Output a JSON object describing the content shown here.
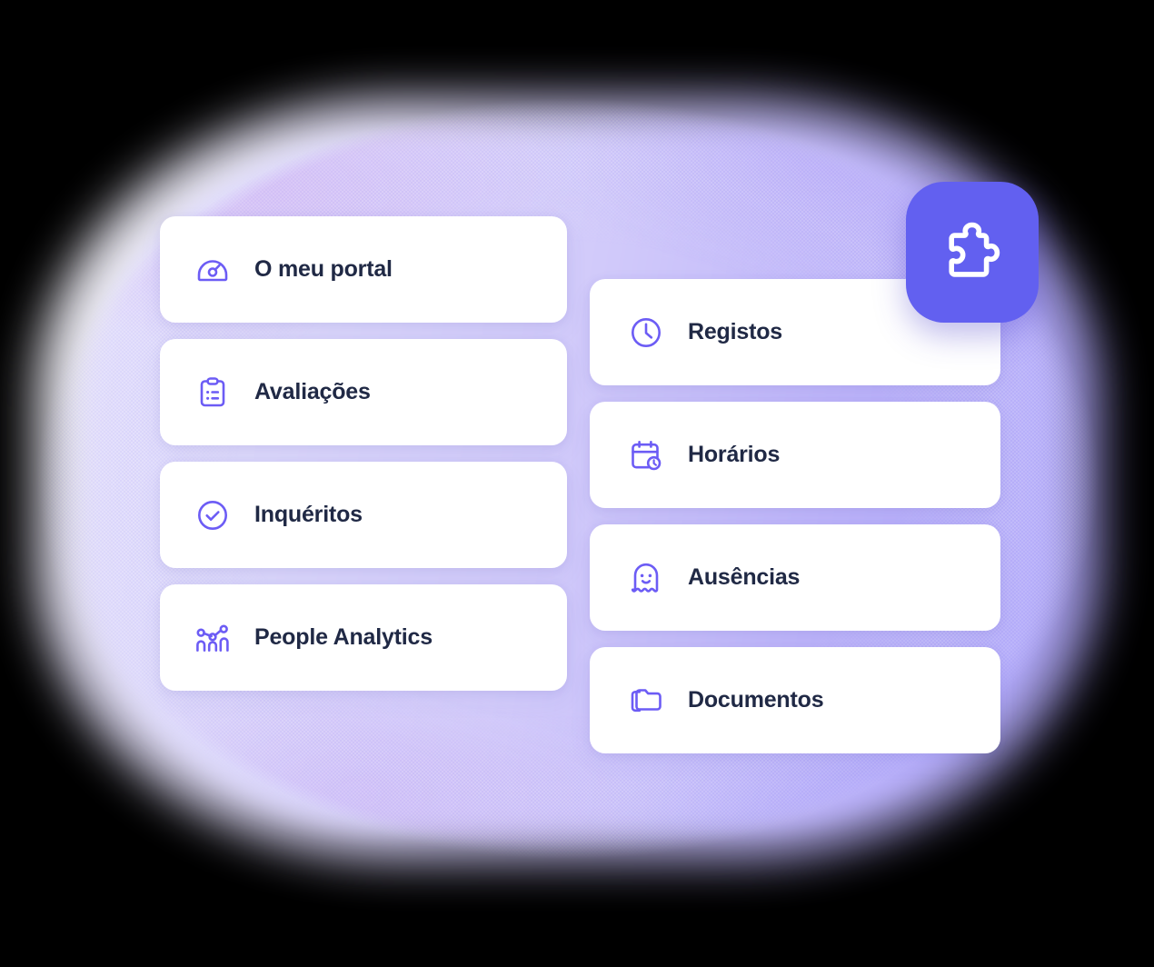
{
  "theme": {
    "accent": "#6260f0",
    "icon_stroke": "#6c5cf5",
    "label_color": "#202945",
    "card_bg": "#ffffff",
    "backdrop_from": "#e6e2fc",
    "backdrop_to": "#ada5fa",
    "page_bg": "#000000"
  },
  "modules": {
    "left_column": [
      {
        "label": "O meu portal",
        "icon": "gauge-icon"
      },
      {
        "label": "Avaliações",
        "icon": "clipboard-checklist-icon"
      },
      {
        "label": "Inquéritos",
        "icon": "check-circle-icon"
      },
      {
        "label": "People Analytics",
        "icon": "analytics-chart-icon"
      }
    ],
    "right_column": [
      {
        "label": "Registos",
        "icon": "clock-icon"
      },
      {
        "label": "Horários",
        "icon": "calendar-clock-icon"
      },
      {
        "label": "Ausências",
        "icon": "ghost-icon"
      },
      {
        "label": "Documentos",
        "icon": "folders-icon"
      }
    ]
  },
  "badge": {
    "icon": "puzzle-piece-icon",
    "color": "#6260f0"
  }
}
